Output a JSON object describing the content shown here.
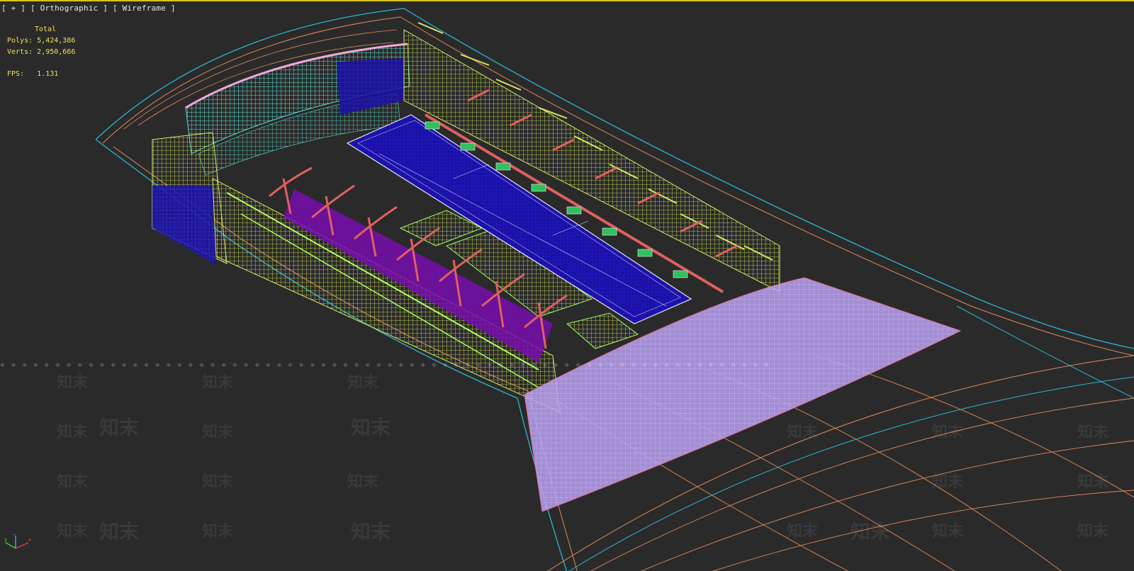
{
  "viewport": {
    "label_plus": "[ + ]",
    "label_view": "[ Orthographic ]",
    "label_shading": "[ Wireframe ]"
  },
  "stats": {
    "header": "Total",
    "polys_label": "Polys:",
    "polys_value": "5,424,386",
    "verts_label": "Verts:",
    "verts_value": "2,950,666",
    "fps_label": "FPS:",
    "fps_value": "1.131"
  },
  "watermark": {
    "text": "知末"
  },
  "axis": {
    "x": "x",
    "y": "y",
    "z": "z"
  },
  "colors": {
    "background": "#2a2a2a",
    "viewport_border": "#d6c420",
    "stats_text": "#f0e060",
    "roof_cyan": "#2ab7d0",
    "roof_orange": "#e08a5a",
    "field_blue": "#1a10a8",
    "stands_yellow": "#d8e860",
    "stands_purple": "#7a0aa8",
    "trusses_red": "#e06060",
    "canopy_lavender": "#b8a0f0",
    "upper_teal": "#5ee0d0"
  }
}
